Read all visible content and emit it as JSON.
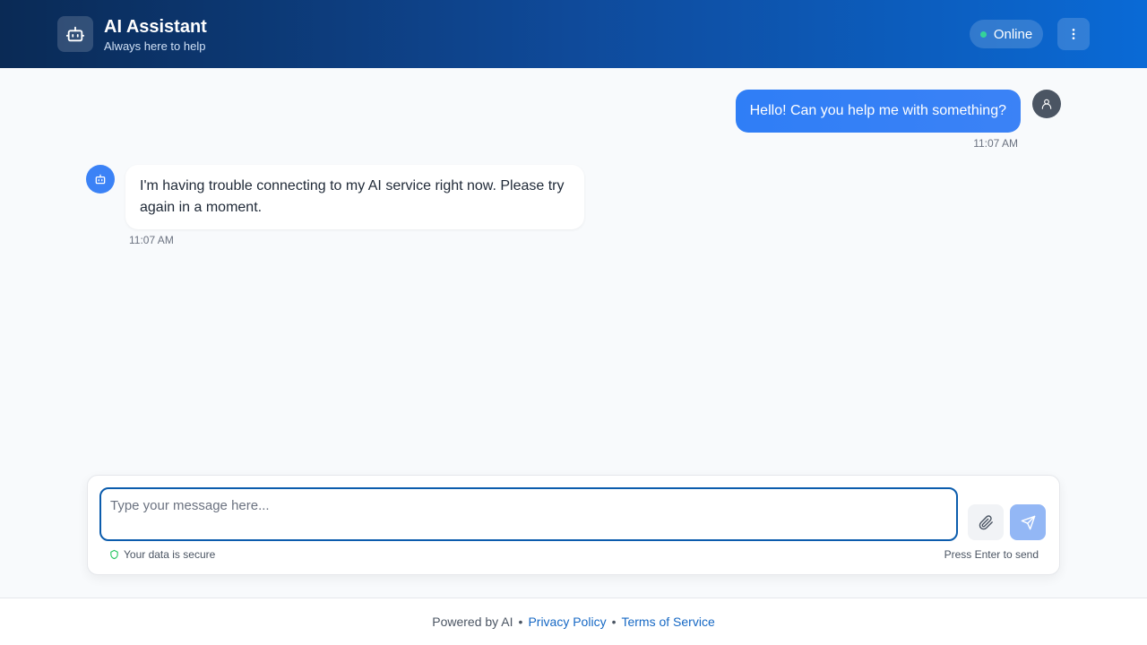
{
  "header": {
    "title": "AI Assistant",
    "subtitle": "Always here to help",
    "status": "Online",
    "logo_icon": "robot-icon",
    "menu_icon": "more-vertical-icon"
  },
  "messages": [
    {
      "role": "user",
      "text": "Hello! Can you help me with something?",
      "time": "11:07 AM",
      "avatar_icon": "user-icon"
    },
    {
      "role": "assistant",
      "text": "I'm having trouble connecting to my AI service right now. Please try again in a moment.",
      "time": "11:07 AM",
      "avatar_icon": "robot-icon"
    }
  ],
  "composer": {
    "placeholder": "Type your message here...",
    "value": "",
    "attach_icon": "paperclip-icon",
    "send_icon": "send-icon",
    "secure_note": "Your data is secure",
    "hint": "Press Enter to send"
  },
  "footer": {
    "powered_by": "Powered by AI",
    "separator": "•",
    "privacy": "Privacy Policy",
    "terms": "Terms of Service"
  },
  "colors": {
    "accent": "#3b82f6",
    "status_dot": "#34d399",
    "link": "#1668c4"
  }
}
